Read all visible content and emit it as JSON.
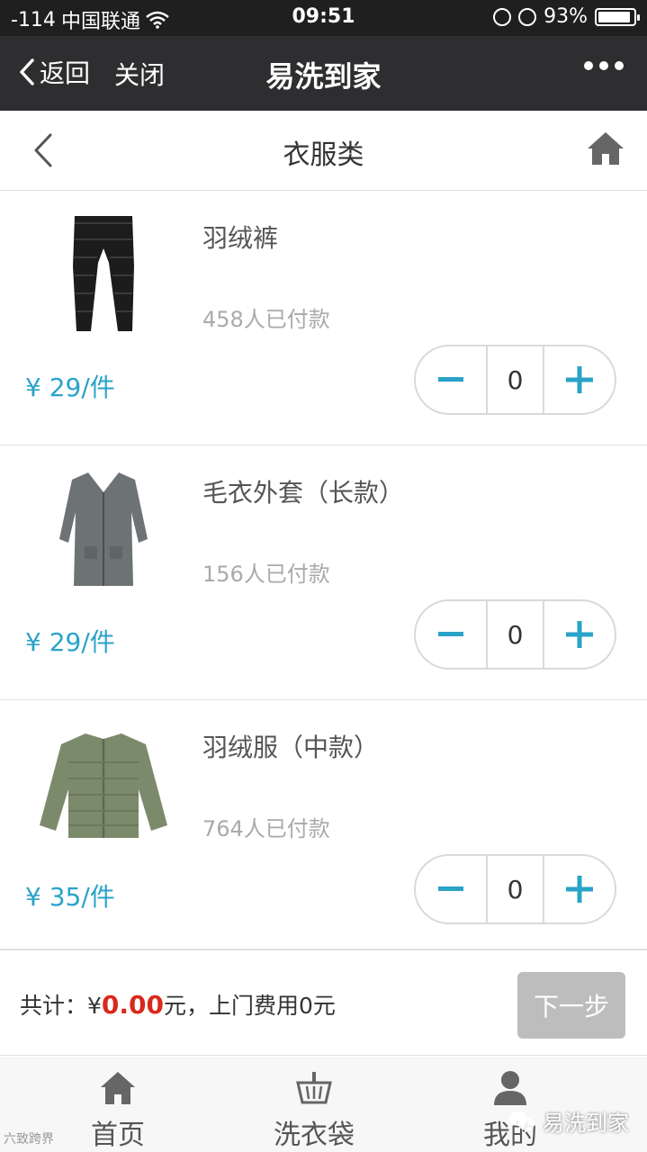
{
  "status_bar": {
    "signal": "-114",
    "carrier": "中国联通",
    "time": "09:51",
    "battery": "93%",
    "battery_level": 0.93
  },
  "nav": {
    "back_label": "返回",
    "close_label": "关闭",
    "title": "易洗到家"
  },
  "page": {
    "title": "衣服类"
  },
  "items": [
    {
      "name": "羽绒裤",
      "sold": "458人已付款",
      "price": "¥ 29/件",
      "qty": "0",
      "image": "down-pants"
    },
    {
      "name": "毛衣外套（长款）",
      "sold": "156人已付款",
      "price": "¥ 29/件",
      "qty": "0",
      "image": "cardigan"
    },
    {
      "name": "羽绒服（中款）",
      "sold": "764人已付款",
      "price": "¥ 35/件",
      "qty": "0",
      "image": "down-jacket"
    }
  ],
  "checkout": {
    "total_label": "共计：",
    "currency": "¥",
    "amount": "0.00",
    "suffix": "元，上门费用0元",
    "next_label": "下一步"
  },
  "tabs": [
    {
      "label": "首页",
      "icon": "home-icon"
    },
    {
      "label": "洗衣袋",
      "icon": "basket-icon"
    },
    {
      "label": "我的",
      "icon": "user-icon"
    }
  ],
  "watermark": {
    "left": "六致跨界",
    "right": "易洗到家"
  },
  "colors": {
    "accent": "#2aa3c9",
    "amount": "#d9291c",
    "nav_bg": "#2e2e30"
  }
}
